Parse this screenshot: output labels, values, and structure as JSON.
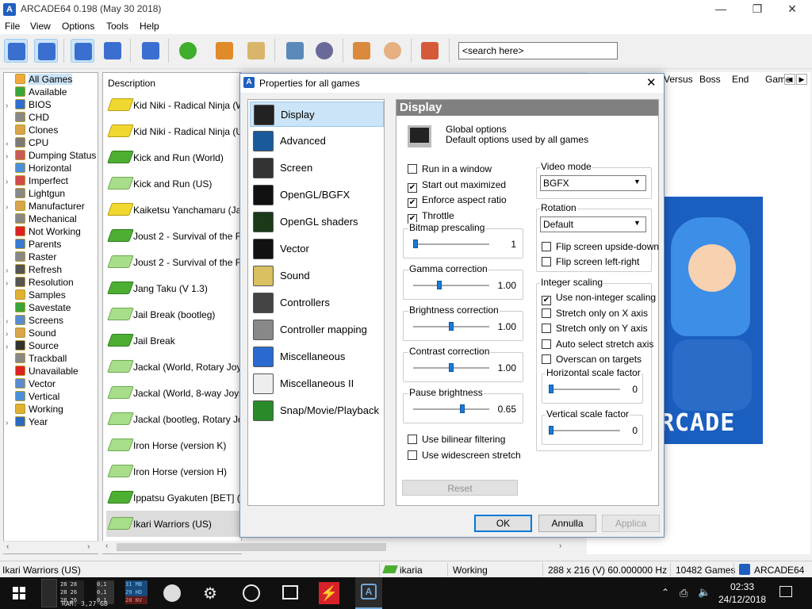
{
  "window": {
    "title": "ARCADE64 0.198 (May 30 2018)",
    "minimize": "—",
    "restore": "❐",
    "close": "✕"
  },
  "menu": [
    "File",
    "View",
    "Options",
    "Tools",
    "Help"
  ],
  "search": {
    "value": "<search here>"
  },
  "folders": [
    {
      "label": "All Games",
      "expand": "",
      "selected": true
    },
    {
      "label": "Available",
      "expand": ""
    },
    {
      "label": "BIOS",
      "expand": "›"
    },
    {
      "label": "CHD",
      "expand": ""
    },
    {
      "label": "Clones",
      "expand": ""
    },
    {
      "label": "CPU",
      "expand": "›"
    },
    {
      "label": "Dumping Status",
      "expand": "›"
    },
    {
      "label": "Horizontal",
      "expand": ""
    },
    {
      "label": "Imperfect",
      "expand": "›"
    },
    {
      "label": "Lightgun",
      "expand": ""
    },
    {
      "label": "Manufacturer",
      "expand": "›"
    },
    {
      "label": "Mechanical",
      "expand": ""
    },
    {
      "label": "Not Working",
      "expand": ""
    },
    {
      "label": "Parents",
      "expand": ""
    },
    {
      "label": "Raster",
      "expand": ""
    },
    {
      "label": "Refresh",
      "expand": "›"
    },
    {
      "label": "Resolution",
      "expand": "›"
    },
    {
      "label": "Samples",
      "expand": ""
    },
    {
      "label": "Savestate",
      "expand": ""
    },
    {
      "label": "Screens",
      "expand": "›"
    },
    {
      "label": "Sound",
      "expand": "›"
    },
    {
      "label": "Source",
      "expand": "›"
    },
    {
      "label": "Trackball",
      "expand": ""
    },
    {
      "label": "Unavailable",
      "expand": ""
    },
    {
      "label": "Vector",
      "expand": ""
    },
    {
      "label": "Vertical",
      "expand": ""
    },
    {
      "label": "Working",
      "expand": ""
    },
    {
      "label": "Year",
      "expand": "›"
    }
  ],
  "gamelist": {
    "header": "Description",
    "rows": [
      {
        "name": "Kid Niki - Radical Ninja (World)",
        "chip": "y"
      },
      {
        "name": "Kid Niki - Radical Ninja (US)",
        "chip": "y"
      },
      {
        "name": "Kick and Run (World)",
        "chip": "g"
      },
      {
        "name": "Kick and Run (US)",
        "chip": "l"
      },
      {
        "name": "Kaiketsu Yanchamaru (Japan)",
        "chip": "y"
      },
      {
        "name": "Joust 2 - Survival of the Fittest",
        "chip": "g"
      },
      {
        "name": "Joust 2 - Survival of the Fittest",
        "chip": "l"
      },
      {
        "name": "Jang Taku (V 1.3)",
        "chip": "g"
      },
      {
        "name": "Jail Break (bootleg)",
        "chip": "l"
      },
      {
        "name": "Jail Break",
        "chip": "g"
      },
      {
        "name": "Jackal (World, Rotary Joystick)",
        "chip": "l"
      },
      {
        "name": "Jackal (World, 8-way Joystick)",
        "chip": "l"
      },
      {
        "name": "Jackal (bootleg, Rotary Joystick)",
        "chip": "l"
      },
      {
        "name": "Iron Horse (version K)",
        "chip": "l"
      },
      {
        "name": "Iron Horse (version H)",
        "chip": "l"
      },
      {
        "name": "Ippatsu Gyakuten [BET] (Japan)",
        "chip": "g"
      },
      {
        "name": "Ikari Warriors (US)",
        "chip": "l",
        "selected": true
      }
    ]
  },
  "right_headers": [
    "Versus",
    "Boss",
    "End",
    "Game"
  ],
  "screenshot": {
    "logo": "RCADE"
  },
  "dialog": {
    "title": "Properties for all games",
    "categories": [
      "Display",
      "Advanced",
      "Screen",
      "OpenGL/BGFX",
      "OpenGL shaders",
      "Vector",
      "Sound",
      "Controllers",
      "Controller mapping",
      "Miscellaneous",
      "Miscellaneous II",
      "Snap/Movie/Playback"
    ],
    "panel_title": "Display",
    "global_options": "Global options",
    "global_desc": "Default options used by all games",
    "checkboxes": [
      {
        "label": "Run in a window",
        "checked": false
      },
      {
        "label": "Start out maximized",
        "checked": true
      },
      {
        "label": "Enforce aspect ratio",
        "checked": true
      },
      {
        "label": "Throttle",
        "checked": true
      }
    ],
    "sliders": [
      {
        "label": "Bitmap prescaling",
        "value": "1",
        "level": 0.0
      },
      {
        "label": "Gamma correction",
        "value": "1.00",
        "level": 0.33
      },
      {
        "label": "Brightness correction",
        "value": "1.00",
        "level": 0.5
      },
      {
        "label": "Contrast correction",
        "value": "1.00",
        "level": 0.5
      },
      {
        "label": "Pause brightness",
        "value": "0.65",
        "level": 0.65
      }
    ],
    "bottom_checks": [
      {
        "label": "Use bilinear filtering",
        "checked": false
      },
      {
        "label": "Use widescreen stretch",
        "checked": false
      }
    ],
    "reset": "Reset",
    "video_mode": {
      "label": "Video mode",
      "value": "BGFX"
    },
    "rotation": {
      "label": "Rotation",
      "value": "Default"
    },
    "rotation_checks": [
      {
        "label": "Flip screen upside-down",
        "checked": false
      },
      {
        "label": "Flip screen left-right",
        "checked": false
      }
    ],
    "integer_scaling": {
      "label": "Integer scaling",
      "checks": [
        {
          "label": "Use non-integer scaling",
          "checked": true
        },
        {
          "label": "Stretch only on X axis",
          "checked": false
        },
        {
          "label": "Stretch only on Y axis",
          "checked": false
        },
        {
          "label": "Auto select stretch axis",
          "checked": false
        },
        {
          "label": "Overscan on targets",
          "checked": false
        }
      ],
      "h_factor": {
        "label": "Horizontal scale factor",
        "value": "0",
        "level": 0.0
      },
      "v_factor": {
        "label": "Vertical scale factor",
        "value": "0",
        "level": 0.0
      }
    },
    "ok": "OK",
    "cancel": "Annulla",
    "apply": "Applica"
  },
  "statusbar": {
    "game": "Ikari Warriors (US)",
    "driver": "ikaria",
    "status": "Working",
    "resolution": "288 x 216 (V) 60.000000 Hz",
    "count": "10482 Games",
    "app": "ARCADE64"
  },
  "taskbar": {
    "mon": [
      "28 28",
      "0,1",
      "31 MB",
      "28 26",
      "0,1",
      "29 HD",
      "28 26",
      "0,1",
      "28 NV"
    ],
    "ram": "RAM: 3,27 GB",
    "time": "02:33",
    "date": "24/12/2018"
  }
}
